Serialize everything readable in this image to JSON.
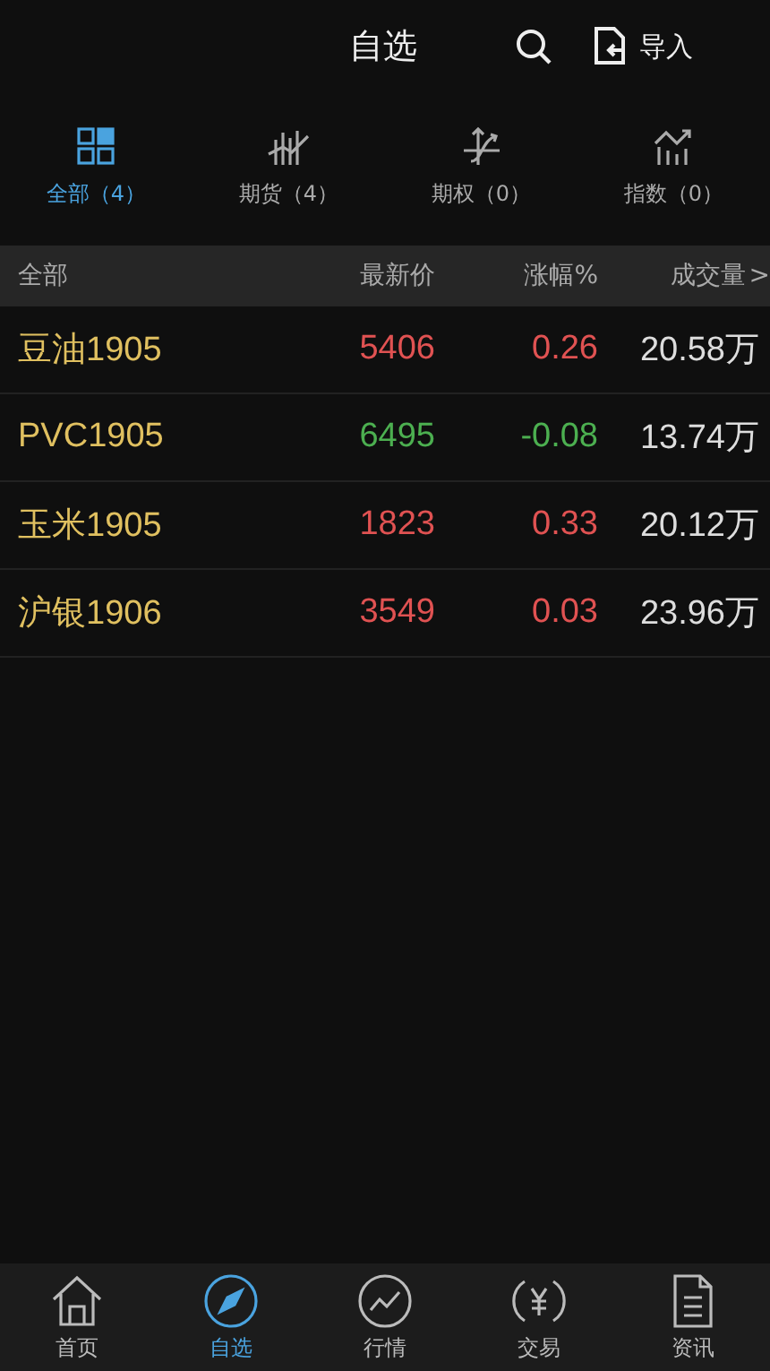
{
  "header": {
    "title": "自选",
    "import_label": "导入"
  },
  "tabs": [
    {
      "kind": "grid",
      "label": "全部（4）",
      "selected": true
    },
    {
      "kind": "candles",
      "label": "期货（4）",
      "selected": false
    },
    {
      "kind": "option",
      "label": "期权（0）",
      "selected": false
    },
    {
      "kind": "index",
      "label": "指数（0）",
      "selected": false
    }
  ],
  "table": {
    "columns": [
      "全部",
      "最新价",
      "涨幅%",
      "成交量"
    ],
    "sort_arrow": ">",
    "rows": [
      {
        "name": "豆油1905",
        "price": "5406",
        "change": "0.26",
        "volume": "20.58万",
        "color": "#e05252"
      },
      {
        "name": "PVC1905",
        "price": "6495",
        "change": "-0.08",
        "volume": "13.74万",
        "color": "#4caf50"
      },
      {
        "name": "玉米1905",
        "price": "1823",
        "change": "0.33",
        "volume": "20.12万",
        "color": "#e05252"
      },
      {
        "name": "沪银1906",
        "price": "3549",
        "change": "0.03",
        "volume": "23.96万",
        "color": "#e05252"
      }
    ]
  },
  "nav": [
    {
      "kind": "home",
      "label": "首页",
      "selected": false
    },
    {
      "kind": "compass",
      "label": "自选",
      "selected": true
    },
    {
      "kind": "chart",
      "label": "行情",
      "selected": false
    },
    {
      "kind": "yen",
      "label": "交易",
      "selected": false
    },
    {
      "kind": "doc",
      "label": "资讯",
      "selected": false
    }
  ]
}
